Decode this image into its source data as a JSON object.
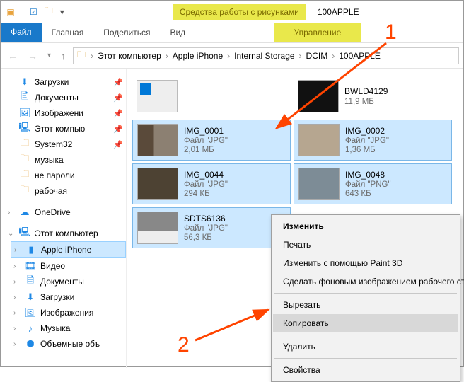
{
  "titlebar": {
    "tool_tab": "Средства работы с рисунками",
    "window_title": "100APPLE"
  },
  "menubar": {
    "file": "Файл",
    "home": "Главная",
    "share": "Поделиться",
    "view": "Вид",
    "manage": "Управление"
  },
  "breadcrumb": {
    "items": [
      "Этот компьютер",
      "Apple iPhone",
      "Internal Storage",
      "DCIM",
      "100APPLE"
    ]
  },
  "sidebar": {
    "quick": [
      {
        "label": "Загрузки",
        "pinned": true,
        "icon": "download"
      },
      {
        "label": "Документы",
        "pinned": true,
        "icon": "doc"
      },
      {
        "label": "Изображени",
        "pinned": true,
        "icon": "pic"
      },
      {
        "label": "Этот компью",
        "pinned": true,
        "icon": "pc"
      },
      {
        "label": "System32",
        "pinned": true,
        "icon": "folder"
      },
      {
        "label": "музыка",
        "pinned": false,
        "icon": "folder"
      },
      {
        "label": "не пароли",
        "pinned": false,
        "icon": "folder"
      },
      {
        "label": "рабочая",
        "pinned": false,
        "icon": "folder"
      }
    ],
    "onedrive": "OneDrive",
    "thispc": {
      "label": "Этот компьютер",
      "children": [
        {
          "label": "Apple iPhone",
          "icon": "phone",
          "selected": true
        },
        {
          "label": "Видео",
          "icon": "video"
        },
        {
          "label": "Документы",
          "icon": "doc"
        },
        {
          "label": "Загрузки",
          "icon": "download"
        },
        {
          "label": "Изображения",
          "icon": "pic"
        },
        {
          "label": "Музыка",
          "icon": "music"
        },
        {
          "label": "Объемные объ",
          "icon": "cube"
        }
      ]
    }
  },
  "files": [
    {
      "name": "",
      "type": "drive",
      "type_text": "",
      "size": ""
    },
    {
      "name": "BWLD4129",
      "type": "vid",
      "type_text": "",
      "size": "11,9 МБ"
    },
    {
      "name": "IMG_0001",
      "type": "jpg1",
      "type_text": "Файл \"JPG\"",
      "size": "2,01 МБ",
      "selected": true
    },
    {
      "name": "IMG_0002",
      "type": "jpg2",
      "type_text": "Файл \"JPG\"",
      "size": "1,36 МБ",
      "selected": true
    },
    {
      "name": "IMG_0044",
      "type": "jpg3",
      "type_text": "Файл \"JPG\"",
      "size": "294 КБ",
      "selected": true
    },
    {
      "name": "IMG_0048",
      "type": "png",
      "type_text": "Файл \"PNG\"",
      "size": "643 КБ",
      "selected": true
    },
    {
      "name": "SDTS6136",
      "type": "pix",
      "type_text": "Файл \"JPG\"",
      "size": "56,3 КБ",
      "selected": true
    }
  ],
  "context_menu": {
    "items": [
      {
        "text": "Изменить",
        "bold": true
      },
      {
        "text": "Печать"
      },
      {
        "text": "Изменить с помощью Paint 3D"
      },
      {
        "text": "Сделать фоновым изображением рабочего стола"
      },
      {
        "sep": true
      },
      {
        "text": "Вырезать"
      },
      {
        "text": "Копировать",
        "hover": true
      },
      {
        "sep": true
      },
      {
        "text": "Удалить"
      },
      {
        "sep": true
      },
      {
        "text": "Свойства"
      }
    ]
  },
  "annotations": {
    "num1": "1",
    "num2": "2"
  }
}
